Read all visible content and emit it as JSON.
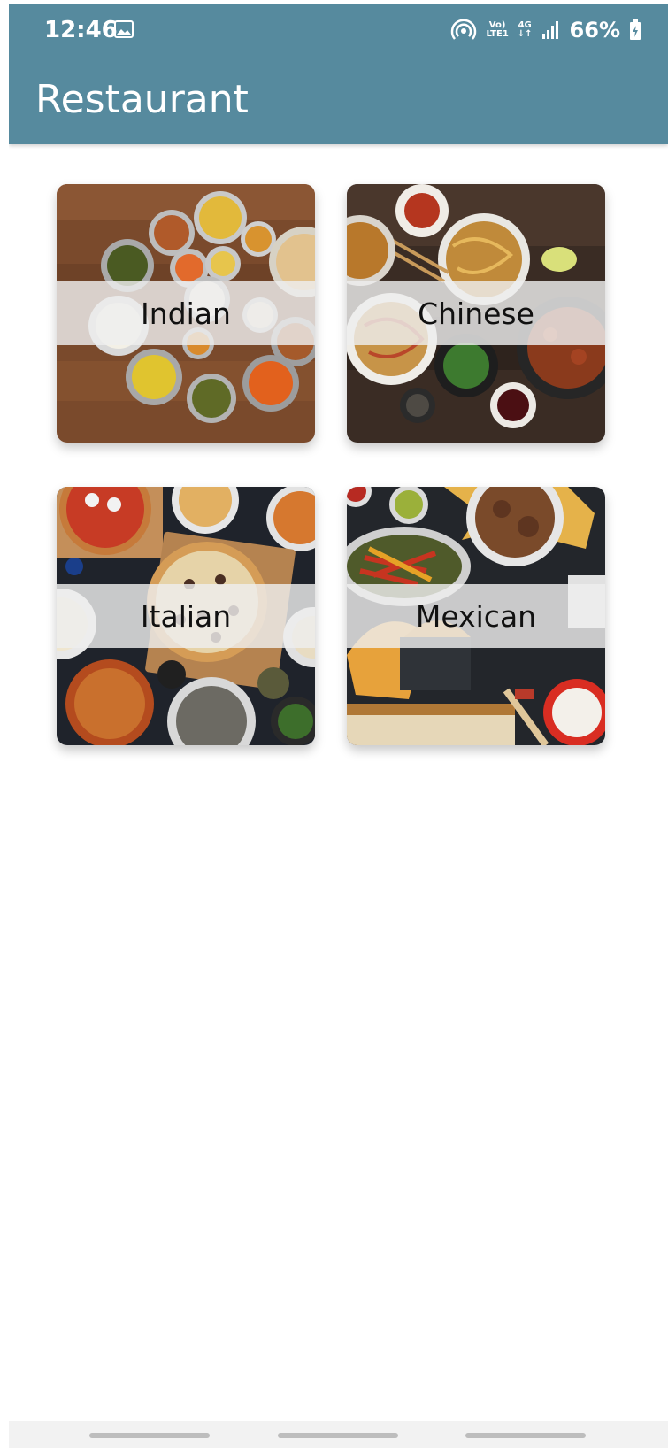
{
  "status_bar": {
    "time": "12:46",
    "network_top": "Vo)",
    "network_bottom": "LTE1",
    "network_type": "4G",
    "battery": "66%"
  },
  "app_bar": {
    "title": "Restaurant",
    "color": "#568a9e"
  },
  "cuisines": [
    {
      "label": "Indian"
    },
    {
      "label": "Chinese"
    },
    {
      "label": "Italian"
    },
    {
      "label": "Mexican"
    }
  ]
}
